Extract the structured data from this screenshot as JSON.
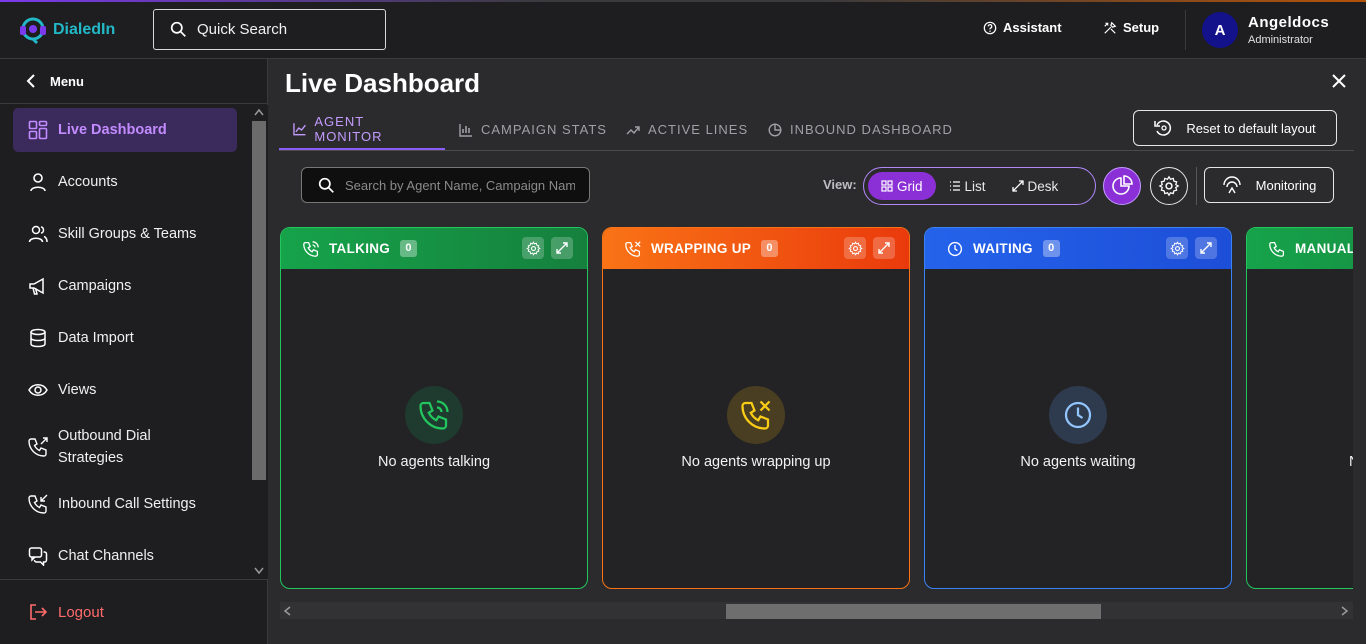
{
  "app": {
    "name": "DialedIn"
  },
  "search": {
    "label": "Quick Search"
  },
  "header": {
    "assistant_label": "Assistant",
    "setup_label": "Setup",
    "user": {
      "initial": "A",
      "name": "Angeldocs",
      "role": "Administrator"
    }
  },
  "sidebar": {
    "menu_label": "Menu",
    "items": [
      {
        "label": "Live Dashboard",
        "icon": "dashboard-icon",
        "active": true
      },
      {
        "label": "Accounts",
        "icon": "user-icon"
      },
      {
        "label": "Skill Groups & Teams",
        "icon": "users-icon"
      },
      {
        "label": "Campaigns",
        "icon": "megaphone-icon"
      },
      {
        "label": "Data Import",
        "icon": "database-icon"
      },
      {
        "label": "Views",
        "icon": "eye-icon"
      },
      {
        "label": "Outbound Dial Strategies",
        "icon": "phone-outgoing-icon"
      },
      {
        "label": "Inbound Call Settings",
        "icon": "phone-incoming-icon"
      },
      {
        "label": "Chat Channels",
        "icon": "chat-icon"
      }
    ],
    "logout_label": "Logout"
  },
  "page": {
    "title": "Live Dashboard"
  },
  "tabs": [
    {
      "label": "AGENT MONITOR",
      "icon": "line-chart-icon",
      "active": true
    },
    {
      "label": "CAMPAIGN STATS",
      "icon": "bar-chart-icon"
    },
    {
      "label": "ACTIVE LINES",
      "icon": "trend-icon"
    },
    {
      "label": "INBOUND DASHBOARD",
      "icon": "pie-chart-icon"
    }
  ],
  "toolbar": {
    "reset_label": "Reset to default layout",
    "agent_search_placeholder": "Search by Agent Name, Campaign Name",
    "view_label": "View:",
    "view_options": [
      "Grid",
      "List",
      "Desk"
    ],
    "view_selected": "Grid",
    "monitoring_label": "Monitoring"
  },
  "cards": [
    {
      "title": "TALKING",
      "count": "0",
      "empty_text": "No agents talking",
      "color": "#16a34a"
    },
    {
      "title": "WRAPPING UP",
      "count": "0",
      "empty_text": "No agents wrapping up",
      "color": "#ea580c"
    },
    {
      "title": "WAITING",
      "count": "0",
      "empty_text": "No agents waiting",
      "color": "#2563eb"
    },
    {
      "title": "MANUAL",
      "count": "",
      "empty_text": "N",
      "color": "#16a34a"
    }
  ],
  "colors": {
    "accent": "#8b5cf6",
    "logout": "#ff6b6b",
    "brand": "#22b8c8"
  }
}
